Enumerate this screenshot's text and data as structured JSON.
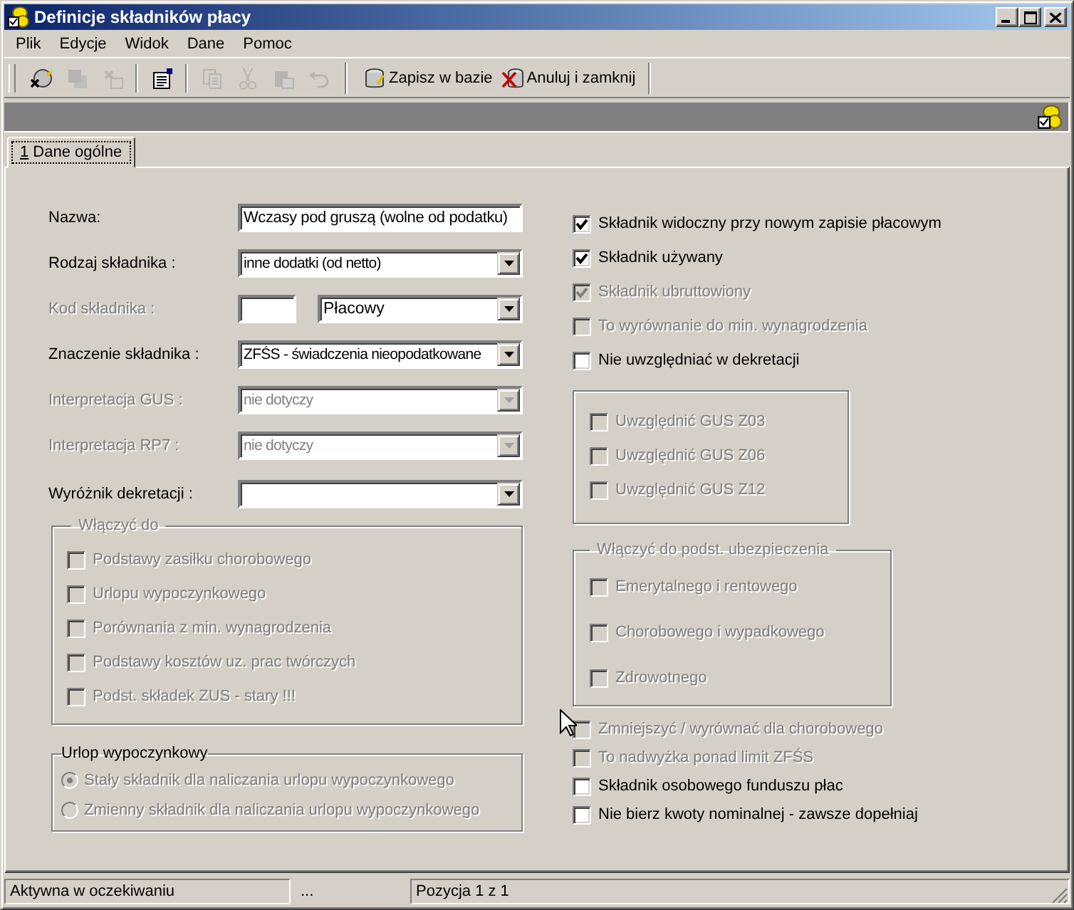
{
  "window": {
    "title": "Definicje składników płacy"
  },
  "menu": [
    "Plik",
    "Edycje",
    "Widok",
    "Dane",
    "Pomoc"
  ],
  "toolbar": [
    {
      "kind": "icon",
      "disabled": false
    },
    {
      "kind": "icon",
      "disabled": true
    },
    {
      "kind": "icon",
      "disabled": true
    },
    {
      "kind": "separator"
    },
    {
      "kind": "icon",
      "disabled": false
    },
    {
      "kind": "separator"
    },
    {
      "kind": "icon",
      "disabled": true
    },
    {
      "kind": "icon",
      "disabled": true
    },
    {
      "kind": "icon",
      "disabled": true
    },
    {
      "kind": "icon",
      "disabled": true
    },
    {
      "kind": "break"
    },
    {
      "kind": "button",
      "label": "Zapisz w bazie",
      "disabled": false
    },
    {
      "kind": "button",
      "label": "Anuluj i zamknij",
      "disabled": false
    }
  ],
  "tabs": [
    {
      "accesskey": "1",
      "label": "Dane ogólne",
      "selected": true
    }
  ],
  "fields": [
    {
      "kind": "text",
      "label": "Nazwa:",
      "value": "Wczasy pod gruszą (wolne od podatku)",
      "disabled": false
    },
    {
      "kind": "combo",
      "label": "Rodzaj składnika :",
      "value": "inne dodatki (od netto)",
      "disabled": false
    },
    {
      "kind": "code",
      "label": "Kod składnika :",
      "value": "Płacowy",
      "disabled": true
    },
    {
      "kind": "combo",
      "label": "Znaczenie składnika :",
      "value": "ZFŚS - świadczenia nieopodatkowane",
      "disabled": false
    },
    {
      "kind": "combo",
      "label": "Interpretacja GUS :",
      "value": "nie dotyczy",
      "disabled": true
    },
    {
      "kind": "combo",
      "label": "Interpretacja RP7 :",
      "value": "nie dotyczy",
      "disabled": true
    },
    {
      "kind": "combo",
      "label": "Wyróżnik dekretacji :",
      "disabled": false
    }
  ],
  "include_group": {
    "title": "Włączyć do",
    "items": [
      {
        "label": "Podstawy zasiłku chorobowego",
        "checked": false,
        "disabled": true
      },
      {
        "label": "Urlopu wypoczynkowego",
        "checked": false,
        "disabled": true
      },
      {
        "label": "Porównania z min. wynagrodzenia",
        "checked": false,
        "disabled": true
      },
      {
        "label": "Podstawy kosztów uz. prac twórczych",
        "checked": false,
        "disabled": true
      },
      {
        "label": "Podst. składek ZUS - stary !!!",
        "checked": false,
        "disabled": true
      }
    ]
  },
  "leave_group": {
    "title": "Urlop wypoczynkowy",
    "options": [
      {
        "label": "Stały składnik dla naliczania urlopu wypoczynkowego",
        "selected": true,
        "disabled": true
      },
      {
        "label": "Zmienny składnik dla naliczania urlopu wypoczynkowego",
        "selected": false,
        "disabled": true
      }
    ]
  },
  "checks": [
    {
      "label": "Składnik widoczny przy nowym zapisie płacowym",
      "checked": true,
      "disabled": false
    },
    {
      "label": "Składnik używany",
      "checked": true,
      "disabled": false
    },
    {
      "label": "Składnik ubruttowiony",
      "checked": true,
      "disabled": true
    },
    {
      "label": "To wyrównanie do min. wynagrodzenia",
      "checked": false,
      "disabled": true
    },
    {
      "label": "Nie uwzględniać w dekretacji",
      "checked": false,
      "disabled": false
    }
  ],
  "gus_box": [
    {
      "label": "Uwzględnić GUS Z03",
      "checked": false,
      "disabled": true
    },
    {
      "label": "Uwzględnić GUS Z06",
      "checked": false,
      "disabled": true
    },
    {
      "label": "Uwzględnić GUS Z12",
      "checked": false,
      "disabled": true
    }
  ],
  "insurance_group": {
    "title": "Włączyć do podst. ubezpieczenia",
    "items": [
      {
        "label": "Emerytalnego i rentowego",
        "checked": false,
        "disabled": true
      },
      {
        "label": "Chorobowego i wypadkowego",
        "checked": false,
        "disabled": true
      },
      {
        "label": "Zdrowotnego",
        "checked": false,
        "disabled": true
      }
    ]
  },
  "extra_checks": [
    {
      "label": "Zmniejszyć / wyrównać dla chorobowego",
      "checked": false,
      "disabled": true
    },
    {
      "label": "To nadwyżka ponad limit ZFŚS",
      "checked": false,
      "disabled": true
    },
    {
      "label": "Składnik osobowego funduszu płac",
      "checked": false,
      "disabled": false
    },
    {
      "label": "Nie bierz kwoty nominalnej - zawsze dopełniaj",
      "checked": false,
      "disabled": false
    }
  ],
  "status_bar": [
    "Aktywna w oczekiwaniu",
    "...",
    "Pozycja 1 z 1"
  ]
}
